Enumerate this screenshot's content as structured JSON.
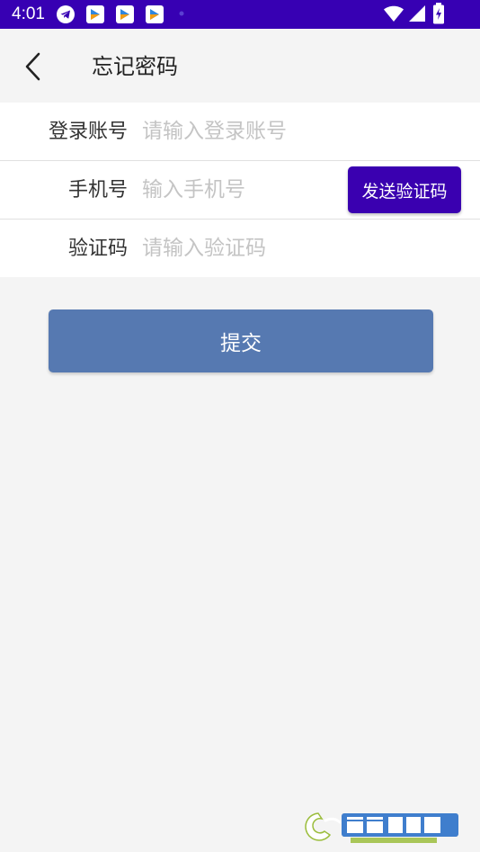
{
  "status_bar": {
    "time": "4:01",
    "background": "#3700b3",
    "left_icons": [
      "telegram-icon",
      "app-notification-icon",
      "app-notification-icon",
      "app-notification-icon",
      "dot-icon"
    ],
    "right_icons": [
      "wifi-icon",
      "signal-icon",
      "battery-charging-icon"
    ]
  },
  "app_bar": {
    "back_icon": "chevron-left-icon",
    "title": "忘记密码"
  },
  "form": {
    "account": {
      "label": "登录账号",
      "placeholder": "请输入登录账号"
    },
    "phone": {
      "label": "手机号",
      "placeholder": "输入手机号",
      "send_code_label": "发送验证码"
    },
    "code": {
      "label": "验证码",
      "placeholder": "请输入验证码"
    }
  },
  "submit": {
    "label": "提交"
  },
  "colors": {
    "accent": "#3a00b0",
    "submit": "#5679b1",
    "page_background": "#f4f4f4"
  },
  "watermark": {
    "logo_text": "西西软件园",
    "sub_text": "CR173.COM"
  }
}
